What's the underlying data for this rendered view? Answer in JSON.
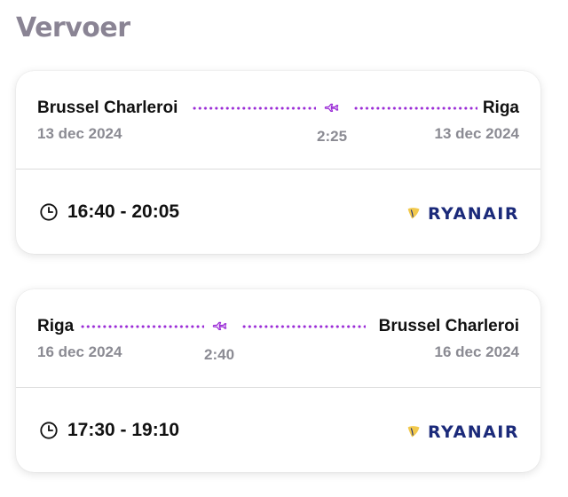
{
  "page": {
    "title": "Vervoer"
  },
  "flights": [
    {
      "from_city": "Brussel Charleroi",
      "to_city": "Riga",
      "from_date": "13 dec 2024",
      "to_date": "13 dec 2024",
      "duration": "2:25",
      "time_range": "16:40 - 20:05",
      "airline": "RYANAIR"
    },
    {
      "from_city": "Riga",
      "to_city": "Brussel Charleroi",
      "from_date": "16 dec 2024",
      "to_date": "16 dec 2024",
      "duration": "2:40",
      "time_range": "17:30 - 19:10",
      "airline": "RYANAIR"
    }
  ],
  "colors": {
    "title": "#8a8494",
    "route_dots": "#9a2bd6",
    "muted_text": "#8b8b93",
    "airline_blue": "#1b2a7a",
    "airline_gold": "#f2c94c"
  },
  "icons": {
    "plane": "airplane-icon",
    "clock": "clock-icon",
    "airline_logo": "ryanair-harp-logo"
  }
}
